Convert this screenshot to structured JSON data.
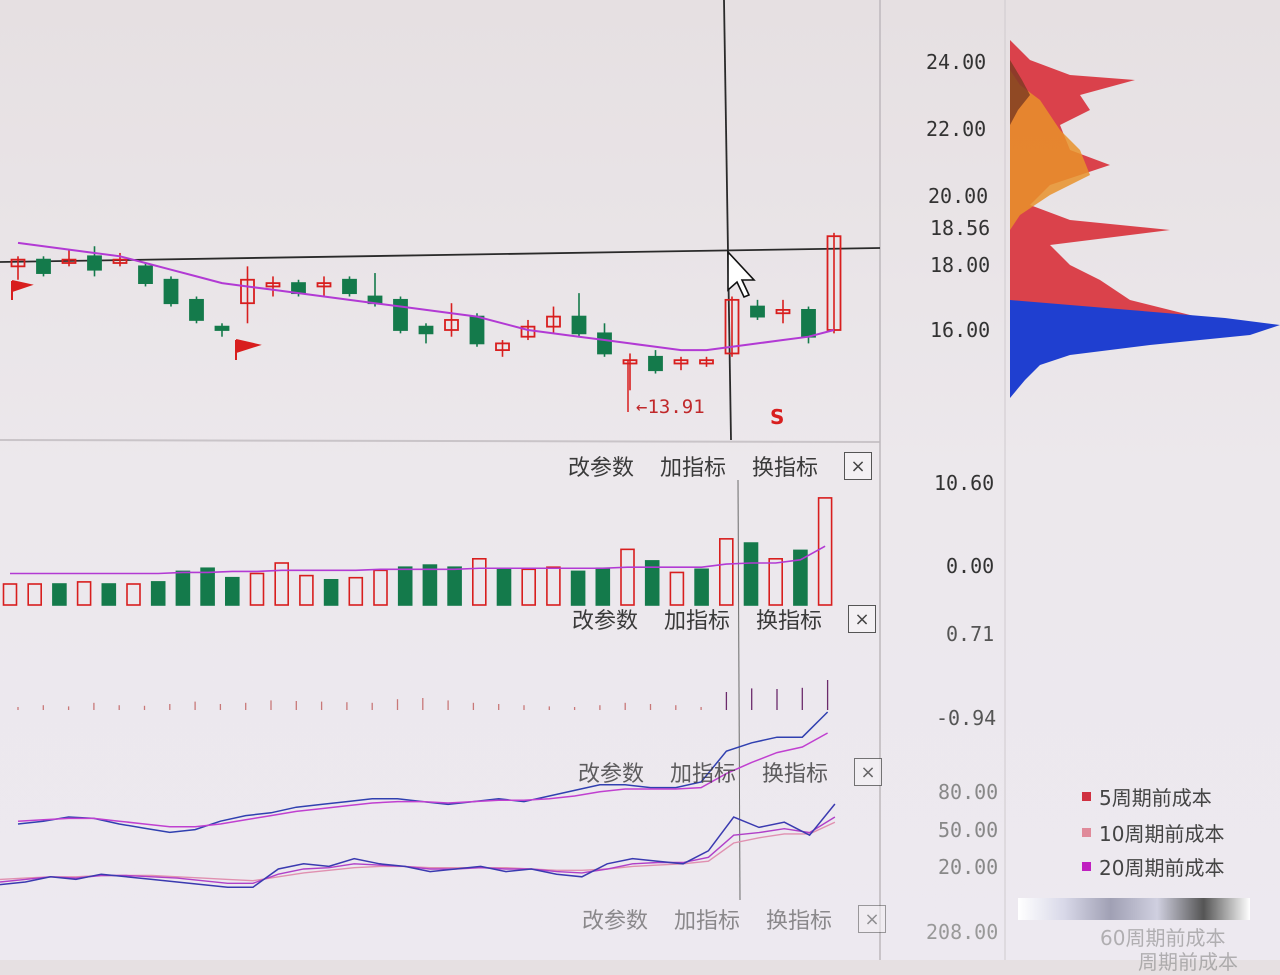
{
  "main_chart": {
    "price_axis_labels": [
      "24.00",
      "22.00",
      "20.00",
      "18.56",
      "18.00",
      "16.00"
    ],
    "low_annotation": "←13.91",
    "signal_label": "S",
    "candles": [
      {
        "o": 17.9,
        "c": 18.1,
        "h": 18.2,
        "l": 17.5,
        "up": true
      },
      {
        "o": 18.1,
        "c": 17.7,
        "h": 18.2,
        "l": 17.6,
        "up": false
      },
      {
        "o": 18.0,
        "c": 18.1,
        "h": 18.4,
        "l": 17.9,
        "up": true
      },
      {
        "o": 18.2,
        "c": 17.8,
        "h": 18.5,
        "l": 17.6,
        "up": false
      },
      {
        "o": 18.1,
        "c": 18.0,
        "h": 18.3,
        "l": 17.9,
        "up": true
      },
      {
        "o": 17.9,
        "c": 17.4,
        "h": 18.0,
        "l": 17.3,
        "up": false
      },
      {
        "o": 17.5,
        "c": 16.8,
        "h": 17.6,
        "l": 16.7,
        "up": false
      },
      {
        "o": 16.9,
        "c": 16.3,
        "h": 17.0,
        "l": 16.2,
        "up": false
      },
      {
        "o": 16.1,
        "c": 16.0,
        "h": 16.2,
        "l": 15.8,
        "up": false
      },
      {
        "o": 16.8,
        "c": 17.5,
        "h": 17.9,
        "l": 16.2,
        "up": true
      },
      {
        "o": 17.3,
        "c": 17.4,
        "h": 17.6,
        "l": 17.0,
        "up": true
      },
      {
        "o": 17.4,
        "c": 17.1,
        "h": 17.5,
        "l": 17.0,
        "up": false
      },
      {
        "o": 17.3,
        "c": 17.4,
        "h": 17.6,
        "l": 17.0,
        "up": true
      },
      {
        "o": 17.5,
        "c": 17.1,
        "h": 17.6,
        "l": 17.0,
        "up": false
      },
      {
        "o": 17.0,
        "c": 16.8,
        "h": 17.7,
        "l": 16.7,
        "up": false
      },
      {
        "o": 16.9,
        "c": 16.0,
        "h": 17.0,
        "l": 15.9,
        "up": false
      },
      {
        "o": 16.1,
        "c": 15.9,
        "h": 16.2,
        "l": 15.6,
        "up": false
      },
      {
        "o": 16.0,
        "c": 16.3,
        "h": 16.8,
        "l": 15.8,
        "up": true
      },
      {
        "o": 16.4,
        "c": 15.6,
        "h": 16.5,
        "l": 15.5,
        "up": false
      },
      {
        "o": 15.4,
        "c": 15.6,
        "h": 15.7,
        "l": 15.2,
        "up": true
      },
      {
        "o": 15.8,
        "c": 16.1,
        "h": 16.3,
        "l": 15.7,
        "up": true
      },
      {
        "o": 16.1,
        "c": 16.4,
        "h": 16.7,
        "l": 15.9,
        "up": true
      },
      {
        "o": 16.4,
        "c": 15.9,
        "h": 17.1,
        "l": 15.8,
        "up": false
      },
      {
        "o": 15.9,
        "c": 15.3,
        "h": 16.2,
        "l": 15.2,
        "up": false
      },
      {
        "o": 15.0,
        "c": 15.1,
        "h": 15.3,
        "l": 14.2,
        "up": true
      },
      {
        "o": 15.2,
        "c": 14.8,
        "h": 15.4,
        "l": 14.7,
        "up": false
      },
      {
        "o": 15.0,
        "c": 15.1,
        "h": 15.2,
        "l": 14.8,
        "up": true
      },
      {
        "o": 15.0,
        "c": 15.1,
        "h": 15.2,
        "l": 14.9,
        "up": true
      },
      {
        "o": 15.3,
        "c": 16.9,
        "h": 17.0,
        "l": 15.2,
        "up": true
      },
      {
        "o": 16.7,
        "c": 16.4,
        "h": 16.9,
        "l": 16.3,
        "up": false
      },
      {
        "o": 16.5,
        "c": 16.6,
        "h": 16.9,
        "l": 16.2,
        "up": true
      },
      {
        "o": 16.6,
        "c": 15.8,
        "h": 16.7,
        "l": 15.6,
        "up": false
      },
      {
        "o": 16.0,
        "c": 18.8,
        "h": 18.9,
        "l": 15.9,
        "up": true
      }
    ],
    "ma_line": [
      18.6,
      18.5,
      18.4,
      18.3,
      18.2,
      18.0,
      17.8,
      17.6,
      17.4,
      17.3,
      17.2,
      17.1,
      17.0,
      16.9,
      16.8,
      16.7,
      16.6,
      16.5,
      16.4,
      16.2,
      16.0,
      15.9,
      15.8,
      15.7,
      15.6,
      15.5,
      15.4,
      15.4,
      15.5,
      15.6,
      15.7,
      15.8,
      16.0
    ]
  },
  "toolbar": {
    "change_params": "改参数",
    "add_indicator": "加指标",
    "switch_indicator": "换指标",
    "close": "×"
  },
  "volume_panel": {
    "axis_labels": [
      "10.60",
      "0.00"
    ],
    "bars": [
      {
        "v": 2.0,
        "up": true
      },
      {
        "v": 2.0,
        "up": true
      },
      {
        "v": 2.0,
        "up": false
      },
      {
        "v": 2.2,
        "up": true
      },
      {
        "v": 2.0,
        "up": false
      },
      {
        "v": 2.0,
        "up": true
      },
      {
        "v": 2.2,
        "up": false
      },
      {
        "v": 3.2,
        "up": false
      },
      {
        "v": 3.5,
        "up": false
      },
      {
        "v": 2.6,
        "up": false
      },
      {
        "v": 3.0,
        "up": true
      },
      {
        "v": 4.0,
        "up": true
      },
      {
        "v": 2.8,
        "up": true
      },
      {
        "v": 2.4,
        "up": false
      },
      {
        "v": 2.6,
        "up": true
      },
      {
        "v": 3.3,
        "up": true
      },
      {
        "v": 3.6,
        "up": false
      },
      {
        "v": 3.8,
        "up": false
      },
      {
        "v": 3.6,
        "up": false
      },
      {
        "v": 4.4,
        "up": true
      },
      {
        "v": 3.4,
        "up": false
      },
      {
        "v": 3.4,
        "up": true
      },
      {
        "v": 3.6,
        "up": true
      },
      {
        "v": 3.2,
        "up": false
      },
      {
        "v": 3.5,
        "up": false
      },
      {
        "v": 5.3,
        "up": true
      },
      {
        "v": 4.2,
        "up": false
      },
      {
        "v": 3.1,
        "up": true
      },
      {
        "v": 3.4,
        "up": false
      },
      {
        "v": 6.3,
        "up": true
      },
      {
        "v": 5.9,
        "up": false
      },
      {
        "v": 4.4,
        "up": true
      },
      {
        "v": 5.2,
        "up": false
      },
      {
        "v": 10.2,
        "up": true
      }
    ],
    "ma_line": [
      3.0,
      3.0,
      3.0,
      3.0,
      3.0,
      3.0,
      3.0,
      3.1,
      3.1,
      3.2,
      3.2,
      3.3,
      3.3,
      3.3,
      3.3,
      3.4,
      3.4,
      3.4,
      3.4,
      3.5,
      3.5,
      3.5,
      3.5,
      3.5,
      3.5,
      3.6,
      3.6,
      3.6,
      3.6,
      3.9,
      4.0,
      4.0,
      4.3,
      5.6
    ]
  },
  "macd_panel": {
    "axis_labels": [
      "0.71",
      "-0.94"
    ],
    "hist": [
      0.05,
      0.08,
      0.06,
      0.12,
      0.08,
      0.07,
      0.1,
      0.14,
      0.1,
      0.12,
      0.16,
      0.15,
      0.14,
      0.13,
      0.12,
      0.18,
      0.2,
      0.16,
      0.12,
      0.1,
      0.08,
      0.06,
      0.05,
      0.08,
      0.12,
      0.1,
      0.08,
      0.05,
      0.3,
      0.36,
      0.35,
      0.37,
      0.5
    ],
    "line1": [
      -0.6,
      -0.58,
      -0.55,
      -0.56,
      -0.6,
      -0.63,
      -0.66,
      -0.64,
      -0.58,
      -0.54,
      -0.52,
      -0.48,
      -0.46,
      -0.44,
      -0.42,
      -0.42,
      -0.44,
      -0.46,
      -0.44,
      -0.42,
      -0.44,
      -0.4,
      -0.36,
      -0.32,
      -0.32,
      -0.34,
      -0.34,
      -0.3,
      -0.08,
      -0.02,
      0.02,
      0.02,
      0.2
    ],
    "line2": [
      -0.58,
      -0.57,
      -0.56,
      -0.56,
      -0.58,
      -0.6,
      -0.62,
      -0.62,
      -0.6,
      -0.57,
      -0.54,
      -0.51,
      -0.49,
      -0.47,
      -0.45,
      -0.44,
      -0.44,
      -0.45,
      -0.44,
      -0.43,
      -0.43,
      -0.42,
      -0.4,
      -0.37,
      -0.35,
      -0.35,
      -0.35,
      -0.34,
      -0.24,
      -0.16,
      -0.09,
      -0.05,
      0.05
    ]
  },
  "kdj_panel": {
    "axis_labels": [
      "80.00",
      "50.00",
      "20.00",
      "208.00"
    ],
    "line_k": [
      8,
      10,
      14,
      12,
      16,
      14,
      12,
      10,
      8,
      6,
      6,
      20,
      24,
      22,
      28,
      24,
      22,
      18,
      20,
      22,
      18,
      20,
      16,
      14,
      24,
      28,
      26,
      24,
      34,
      60,
      52,
      56,
      46,
      70
    ],
    "line_d": [
      10,
      12,
      14,
      13,
      15,
      15,
      14,
      13,
      11,
      9,
      9,
      16,
      20,
      21,
      24,
      23,
      22,
      20,
      20,
      21,
      20,
      20,
      18,
      17,
      20,
      24,
      25,
      25,
      29,
      46,
      48,
      51,
      48,
      60
    ],
    "line_j": [
      12,
      13,
      14,
      14,
      15,
      15,
      15,
      14,
      13,
      12,
      11,
      14,
      17,
      19,
      21,
      22,
      22,
      21,
      21,
      21,
      21,
      20,
      19,
      19,
      20,
      22,
      23,
      24,
      26,
      40,
      44,
      47,
      47,
      56
    ]
  },
  "chip_legend": {
    "items": [
      {
        "label": "5周期前成本",
        "color": "#d03040"
      },
      {
        "label": "10周期前成本",
        "color": "#e08a9a"
      },
      {
        "label": "20周期前成本",
        "color": "#c020c0"
      }
    ],
    "partial_label_1": "60周期前成本",
    "partial_label_2": "周期前成本"
  },
  "colors": {
    "up": "#d81e1e",
    "down": "#147a4b",
    "ma": "#b23ad4",
    "grid": "#1a1a1a",
    "chip_red": "#d8303a",
    "chip_orange": "#e8922a",
    "chip_blue": "#1f3fd0",
    "chip_brown": "#7a3a22"
  }
}
